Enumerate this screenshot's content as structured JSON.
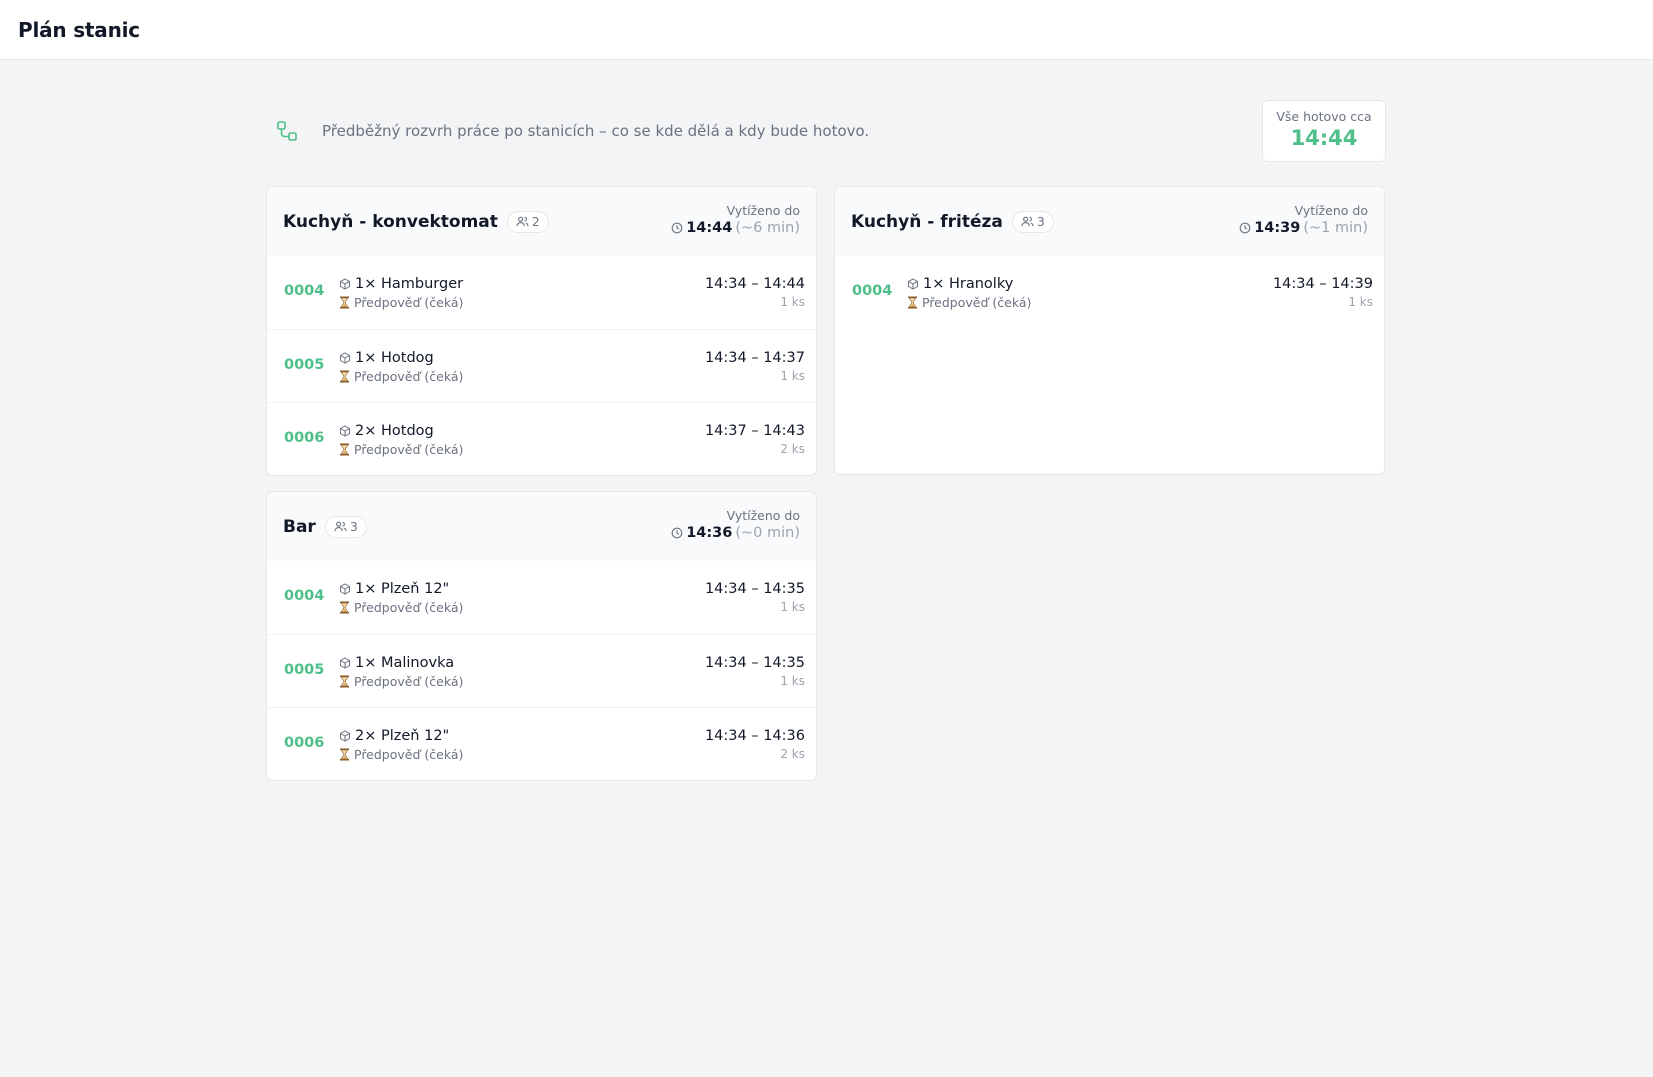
{
  "header": {
    "title": "Plán stanic"
  },
  "intro": {
    "icon": "workflow-icon",
    "text": "Předběžný rozvrh práce po stanicích – co se kde dělá a kdy bude hotovo."
  },
  "summary": {
    "label": "Vše hotovo cca",
    "time": "14:44"
  },
  "colors": {
    "accent": "#4ebf88",
    "muted": "#6b7280"
  },
  "stations": [
    {
      "name": "Kuchyň - konvektomat",
      "staff": "2",
      "busy_label": "Vytíženo do",
      "busy_time": "14:44",
      "busy_rest": "(~6 min)",
      "rows": [
        {
          "order": "0004",
          "item": "1× Hamburger",
          "state": "Předpověď (čeká)",
          "range": "14:34 – 14:44",
          "qty": "1 ks"
        },
        {
          "order": "0005",
          "item": "1× Hotdog",
          "state": "Předpověď (čeká)",
          "range": "14:34 – 14:37",
          "qty": "1 ks"
        },
        {
          "order": "0006",
          "item": "2× Hotdog",
          "state": "Předpověď (čeká)",
          "range": "14:37 – 14:43",
          "qty": "2 ks"
        }
      ]
    },
    {
      "name": "Kuchyň - fritéza",
      "staff": "3",
      "busy_label": "Vytíženo do",
      "busy_time": "14:39",
      "busy_rest": "(~1 min)",
      "rows": [
        {
          "order": "0004",
          "item": "1× Hranolky",
          "state": "Předpověď (čeká)",
          "range": "14:34 – 14:39",
          "qty": "1 ks"
        }
      ]
    },
    {
      "name": "Bar",
      "staff": "3",
      "busy_label": "Vytíženo do",
      "busy_time": "14:36",
      "busy_rest": "(~0 min)",
      "rows": [
        {
          "order": "0004",
          "item": "1× Plzeň 12\"",
          "state": "Předpověď (čeká)",
          "range": "14:34 – 14:35",
          "qty": "1 ks"
        },
        {
          "order": "0005",
          "item": "1× Malinovka",
          "state": "Předpověď (čeká)",
          "range": "14:34 – 14:35",
          "qty": "1 ks"
        },
        {
          "order": "0006",
          "item": "2× Plzeň 12\"",
          "state": "Předpověď (čeká)",
          "range": "14:34 – 14:36",
          "qty": "2 ks"
        }
      ]
    }
  ]
}
